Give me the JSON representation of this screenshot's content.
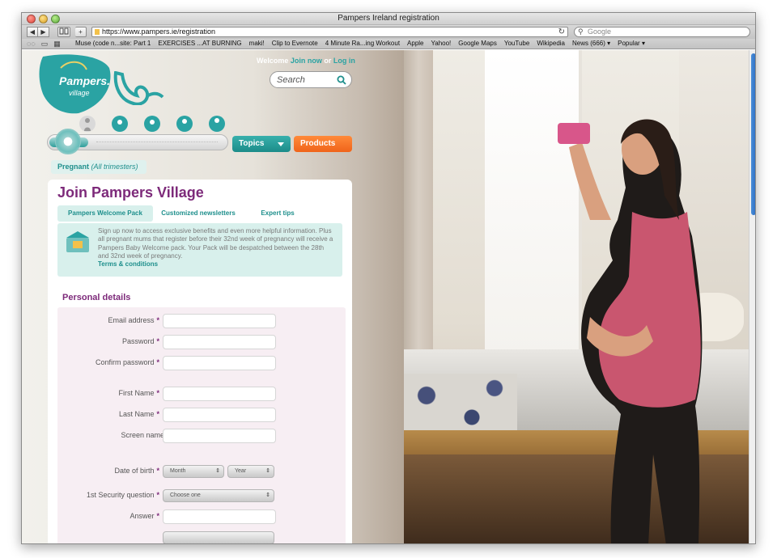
{
  "window": {
    "title": "Pampers Ireland registration"
  },
  "toolbar": {
    "back": "◀",
    "forward": "▶",
    "add": "+",
    "url": "https://www.pampers.ie/registration",
    "search_placeholder": "Google",
    "reload": "↻"
  },
  "bookmarks": [
    "Muse (code n...site: Part 1",
    "EXERCISES ...AT BURNING",
    "maki!",
    "Clip to Evernote",
    "4 Minute Ra...ing Workout",
    "Apple",
    "Yahoo!",
    "Google Maps",
    "YouTube",
    "Wikipedia",
    "News (666) ▾",
    "Popular ▾"
  ],
  "site": {
    "logo_text": "Pampers.",
    "logo_sub": "village",
    "welcome": "Welcome",
    "join_now": "Join now",
    "or": "or",
    "log_in": "Log in",
    "search_placeholder": "Search",
    "topics": "Topics",
    "products": "Products",
    "stage_label": "Pregnant",
    "stage_sub": "(All trimesters)",
    "slider_position_pct": 20
  },
  "panel": {
    "title": "Join Pampers Village",
    "tabs": [
      "Pampers Welcome Pack",
      "Customized newsletters",
      "Expert tips"
    ],
    "info_text": "Sign up now to access exclusive benefits and even more helpful information. Plus all pregnant mums that register before their 32nd week of pregnancy will receive a Pampers Baby Welcome pack. Your Pack will be despatched between the 28th and 32nd week of pregnancy.",
    "info_link": "Terms & conditions",
    "section_title": "Personal details",
    "fields": {
      "email": "Email address",
      "password": "Password",
      "confirm": "Confirm password",
      "first": "First Name",
      "last": "Last Name",
      "screen": "Screen name",
      "dob": "Date of birth",
      "security": "1st Security question",
      "answer": "Answer"
    },
    "required_mark": "*",
    "selects": {
      "month": "Month",
      "year": "Year",
      "choose": "Choose one",
      "arrow": "⇕"
    }
  },
  "colors": {
    "teal": "#1e8f8c",
    "purple": "#7d2a7a",
    "orange": "#f0641a"
  }
}
